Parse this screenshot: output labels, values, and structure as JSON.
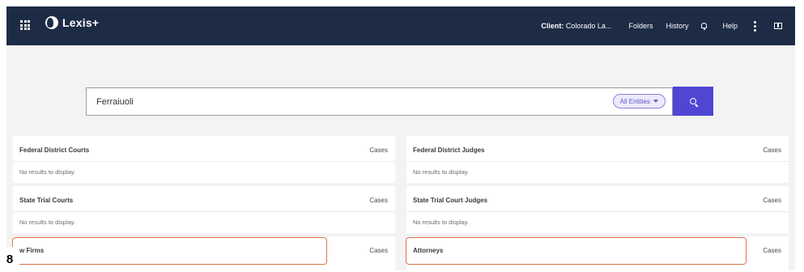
{
  "header": {
    "brand": "Lexis+",
    "client_label": "Client:",
    "client_value": "Colorado La...",
    "nav_folders": "Folders",
    "nav_history": "History",
    "nav_help": "Help"
  },
  "search": {
    "query": "Ferraiuoli",
    "filter_label": "All Entities"
  },
  "cards": [
    {
      "title": "Federal District Courts",
      "tab": "Cases",
      "empty": "No results to display."
    },
    {
      "title": "Federal District Judges",
      "tab": "Cases",
      "empty": "No results to display."
    },
    {
      "title": "State Trial Courts",
      "tab": "Cases",
      "empty": "No results to display."
    },
    {
      "title": "State Trial Court Judges",
      "tab": "Cases",
      "empty": "No results to display."
    },
    {
      "title": "w Firms",
      "tab": "Cases"
    },
    {
      "title": "Attorneys",
      "tab": "Cases"
    }
  ],
  "step_number": "8",
  "colors": {
    "header_bg": "#1d2b45",
    "search_button": "#4f46d3",
    "highlight": "#e07447"
  }
}
